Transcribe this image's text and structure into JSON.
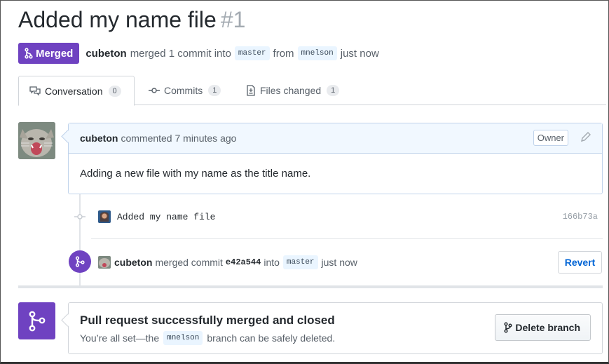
{
  "pr": {
    "title": "Added my name file",
    "number": "#1",
    "state_label": "Merged",
    "author": "cubeton",
    "merge_text": "merged 1 commit into",
    "base_branch": "master",
    "from_text": "from",
    "head_branch": "mnelson",
    "time": "just now"
  },
  "tabs": [
    {
      "label": "Conversation",
      "count": "0",
      "icon": "comment-discussion-icon",
      "active": true
    },
    {
      "label": "Commits",
      "count": "1",
      "icon": "git-commit-icon",
      "active": false
    },
    {
      "label": "Files changed",
      "count": "1",
      "icon": "file-diff-icon",
      "active": false
    }
  ],
  "comment": {
    "author": "cubeton",
    "meta": "commented 7 minutes ago",
    "role_badge": "Owner",
    "body": "Adding a new file with my name as the title name."
  },
  "commit": {
    "message": "Added my name file",
    "sha": "166b73a"
  },
  "merge_event": {
    "actor": "cubeton",
    "text": "merged commit",
    "sha": "e42a544",
    "into_text": "into",
    "branch": "master",
    "time": "just now",
    "revert_label": "Revert"
  },
  "merge_box": {
    "title": "Pull request successfully merged and closed",
    "sub_prefix": "You’re all set—the",
    "branch": "mnelson",
    "sub_suffix": "branch can be safely deleted.",
    "delete_label": "Delete branch"
  },
  "colors": {
    "merged_purple": "#6f42c1",
    "link_blue": "#0366d6",
    "comment_header_bg": "#f1f8ff"
  }
}
